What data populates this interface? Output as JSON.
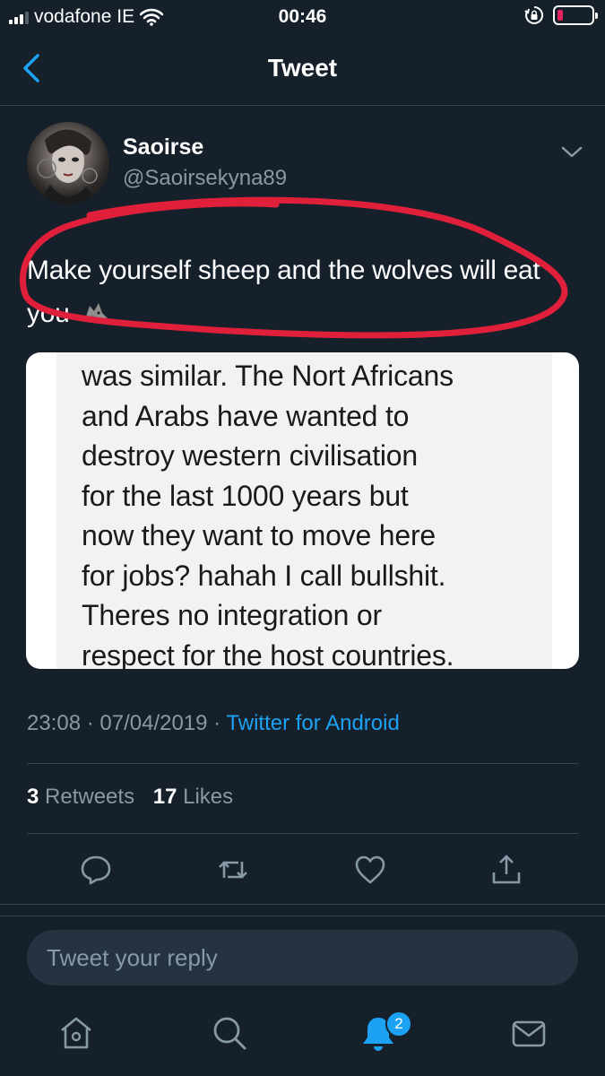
{
  "status_bar": {
    "carrier": "vodafone IE",
    "time": "00:46"
  },
  "header": {
    "title": "Tweet"
  },
  "tweet": {
    "author_name": "Saoirse",
    "author_handle": "@Saoirsekyna89",
    "text": "Make yourself sheep and the wolves will eat you",
    "image_text_lines": [
      "was similar. The Nort Africans",
      "and Arabs have wanted to",
      "destroy western civilisation",
      "for the last 1000 years but",
      "now they want to move here",
      "for jobs? hahah I call bullshit.",
      "Theres no integration or",
      "respect for the host countries."
    ],
    "timestamp": "23:08 · 07/04/2019 · ",
    "source": "Twitter for Android",
    "retweets_count": "3",
    "retweets_label": "Retweets",
    "likes_count": "17",
    "likes_label": "Likes"
  },
  "reply": {
    "placeholder": "Tweet your reply"
  },
  "tab_bar": {
    "notification_badge": "2"
  },
  "colors": {
    "background": "#15202b",
    "accent": "#1da1f2",
    "secondary_text": "#8899a6",
    "annotation_red": "#e0203a"
  },
  "icons": [
    "signal-icon",
    "wifi-icon",
    "orientation-lock-icon",
    "battery-icon",
    "back-icon",
    "chevron-down-icon",
    "wolf-emoji-icon",
    "reply-icon",
    "retweet-icon",
    "like-icon",
    "share-icon",
    "home-icon",
    "search-icon",
    "notifications-icon",
    "messages-icon"
  ]
}
